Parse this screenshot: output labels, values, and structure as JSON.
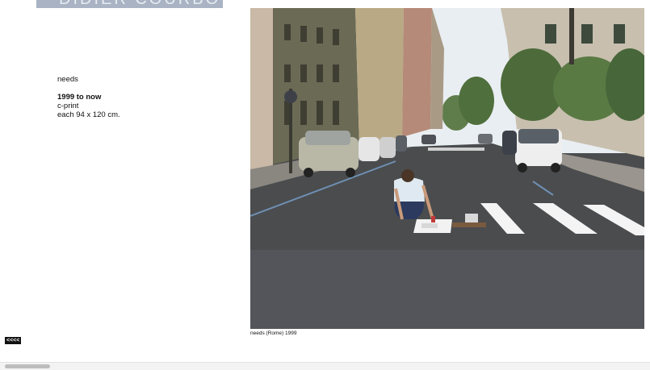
{
  "site": {
    "banner_text": "DIDIER COURBOT"
  },
  "work": {
    "series": "needs",
    "years": "1999 to now",
    "medium": "c-print",
    "dimensions": "each 94 x 120 cm."
  },
  "image": {
    "caption": "needs (Rome) 1999"
  },
  "nav": {
    "back_label": "<<<<"
  },
  "colors": {
    "banner": "#a9b3c3",
    "asphalt": "#4a4c4e",
    "sky": "#e9eef2",
    "crosswalk": "#f4f4f4"
  }
}
